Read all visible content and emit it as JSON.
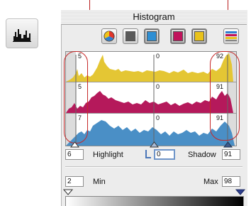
{
  "window": {
    "title": "Histogram"
  },
  "toolbar": {
    "buttons": [
      {
        "name": "all-channels-button",
        "icon": "color-wheel-icon"
      },
      {
        "name": "black-channel-button",
        "icon": "black-square-icon",
        "color": "#5a5a5a"
      },
      {
        "name": "cyan-channel-button",
        "icon": "cyan-square-icon",
        "color": "#2e8fd4"
      },
      {
        "name": "magenta-channel-button",
        "icon": "magenta-square-icon",
        "color": "#c0135c"
      },
      {
        "name": "yellow-channel-button",
        "icon": "yellow-square-icon",
        "color": "#e9c21a"
      }
    ],
    "levels_icon": "levels-icon"
  },
  "histograms": [
    {
      "channel": "yellow",
      "color": "#e4c634",
      "highlight": "5",
      "mid": "0",
      "shadow": "92"
    },
    {
      "channel": "magenta",
      "color": "#b5195b",
      "highlight": "5",
      "mid": "0",
      "shadow": "91"
    },
    {
      "channel": "cyan",
      "color": "#4a8fc6",
      "highlight": "7",
      "mid": "0",
      "shadow": "91"
    }
  ],
  "controls": {
    "highlight_value": "6",
    "highlight_label": "Highlight",
    "mid_value": "0",
    "shadow_label": "Shadow",
    "shadow_value": "91"
  },
  "output": {
    "min_value": "2",
    "min_label": "Min",
    "max_label": "Max",
    "max_value": "98"
  },
  "colors": {
    "accent_focus": "#6f95c9",
    "marker": "#3d5a8c",
    "guide_line": "#b71c1c"
  }
}
